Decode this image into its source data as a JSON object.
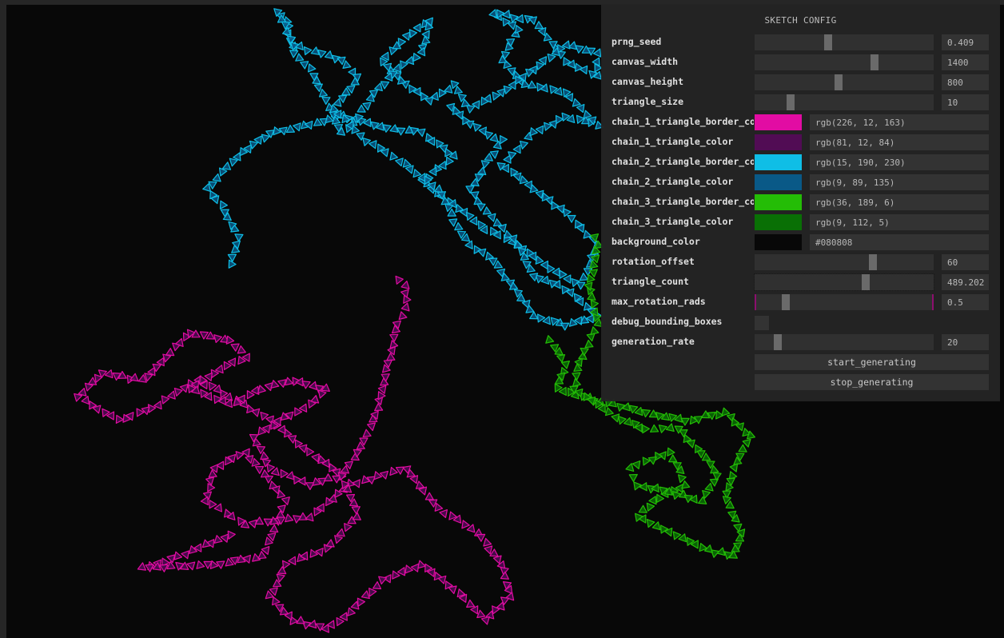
{
  "panel": {
    "title": "SKETCH CONFIG",
    "controls": [
      {
        "key": "prng_seed",
        "label": "prng_seed",
        "type": "slider",
        "value": "0.409",
        "fraction": 0.41
      },
      {
        "key": "canvas_width",
        "label": "canvas_width",
        "type": "slider",
        "value": "1400",
        "fraction": 0.67
      },
      {
        "key": "canvas_height",
        "label": "canvas_height",
        "type": "slider",
        "value": "800",
        "fraction": 0.47
      },
      {
        "key": "triangle_size",
        "label": "triangle_size",
        "type": "slider",
        "value": "10",
        "fraction": 0.2
      },
      {
        "key": "chain_1_triangle_border_color",
        "label": "chain_1_triangle_border_col",
        "type": "color",
        "value": "rgb(226, 12, 163)",
        "swatch": "#e20ca3"
      },
      {
        "key": "chain_1_triangle_color",
        "label": "chain_1_triangle_color",
        "type": "color",
        "value": "rgb(81, 12, 84)",
        "swatch": "#510c54"
      },
      {
        "key": "chain_2_triangle_border_color",
        "label": "chain_2_triangle_border_col",
        "type": "color",
        "value": "rgb(15, 190, 230)",
        "swatch": "#0fbee6"
      },
      {
        "key": "chain_2_triangle_color",
        "label": "chain_2_triangle_color",
        "type": "color",
        "value": "rgb(9, 89, 135)",
        "swatch": "#095987"
      },
      {
        "key": "chain_3_triangle_border_color",
        "label": "chain_3_triangle_border_col",
        "type": "color",
        "value": "rgb(36, 189, 6)",
        "swatch": "#24bd06"
      },
      {
        "key": "chain_3_triangle_color",
        "label": "chain_3_triangle_color",
        "type": "color",
        "value": "rgb(9, 112, 5)",
        "swatch": "#097005"
      },
      {
        "key": "background_color",
        "label": "background_color",
        "type": "color",
        "value": "#080808",
        "swatch": "#080808"
      },
      {
        "key": "rotation_offset",
        "label": "rotation_offset",
        "type": "slider",
        "value": "60",
        "fraction": 0.66
      },
      {
        "key": "triangle_count",
        "label": "triangle_count",
        "type": "slider",
        "value": "489.202",
        "fraction": 0.62
      },
      {
        "key": "max_rotation_rads",
        "label": "max_rotation_rads",
        "type": "slider",
        "value": "0.5",
        "fraction": 0.17
      },
      {
        "key": "debug_bounding_boxes",
        "label": "debug_bounding_boxes",
        "type": "checkbox",
        "checked": false
      },
      {
        "key": "generation_rate",
        "label": "generation_rate",
        "type": "slider",
        "value": "20",
        "fraction": 0.13
      }
    ],
    "buttons": {
      "start": "start_generating",
      "stop": "stop_generating"
    }
  },
  "sketch": {
    "background": "#080808",
    "chains": [
      {
        "name": "chain-1",
        "border": "#e20ca3",
        "fill": "#510c54"
      },
      {
        "name": "chain-2",
        "border": "#0fbee6",
        "fill": "#095987"
      },
      {
        "name": "chain-3",
        "border": "#24bd06",
        "fill": "#097005"
      }
    ]
  }
}
